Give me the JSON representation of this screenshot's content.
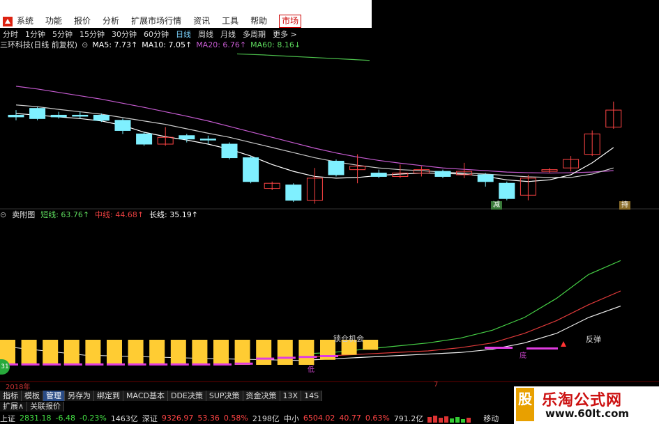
{
  "menu": {
    "items": [
      "系统",
      "功能",
      "报价",
      "分析",
      "扩展市场行情",
      "资讯",
      "工具",
      "帮助",
      "市场"
    ],
    "active_index": 8
  },
  "periods": {
    "items": [
      "分时",
      "1分钟",
      "5分钟",
      "15分钟",
      "30分钟",
      "60分钟",
      "日线",
      "周线",
      "月线",
      "多周期",
      "更多 >"
    ],
    "active_index": 6
  },
  "main_title": {
    "stock": "三环科技(日线 前复权)",
    "ma5": "MA5: 7.73↑",
    "ma10": "MA10: 7.05↑",
    "ma20": "MA20: 6.76↑",
    "ma60": "MA60: 8.16↓"
  },
  "sub_title": {
    "name": "卖附图",
    "short": "短线: 63.76↑",
    "mid": "中线: 44.68↑",
    "long": "长线: 35.19↑"
  },
  "annotations": {
    "buy_label": "减",
    "sell_label": "持",
    "bottom_label": "低",
    "mid_label": "底",
    "band_label": "锁仓机会",
    "rebound_label": "反弹"
  },
  "yearbar": {
    "year": "2018年",
    "month": "7"
  },
  "tabs": {
    "items": [
      "指标",
      "模板",
      "管理",
      "另存为",
      "绑定到",
      "MACD基本",
      "DDE决策",
      "SUP决策",
      "资金决策",
      "13X",
      "14S"
    ],
    "active_index": 2
  },
  "bottom_tabs": {
    "items": [
      "扩展∧",
      "关联报价"
    ]
  },
  "status": {
    "sh_name": "上证",
    "sh_val": "2831.18",
    "sh_chg": "-6.48",
    "sh_pct": "-0.23%",
    "sh_vol": "1463亿",
    "sz_name": "深证",
    "sz_val": "9326.97",
    "sz_chg": "53.36",
    "sz_pct": "0.58%",
    "sz_vol": "2198亿",
    "zx_name": "中小",
    "zx_val": "6504.02",
    "zx_chg": "40.77",
    "zx_pct": "0.63%",
    "zx_vol": "791.2亿",
    "move_label": "移动"
  },
  "watermark": {
    "title": "乐淘公式网",
    "url": "www.60lt.com",
    "mark": "股"
  },
  "circle_badge": "31",
  "colors": {
    "up": "#ff4444",
    "down_fill": "#7ff0ff",
    "ma20": "#c65bd1",
    "ma60": "#4cc04c",
    "bar_yellow": "#ffcc33",
    "bar_magenta": "#e03ce0"
  },
  "chart_data": {
    "type": "candlestick",
    "candles": [
      {
        "o": 7.55,
        "c": 7.5,
        "h": 7.7,
        "l": 7.4
      },
      {
        "o": 7.75,
        "c": 7.45,
        "h": 7.8,
        "l": 7.4
      },
      {
        "o": 7.55,
        "c": 7.5,
        "h": 7.65,
        "l": 7.45
      },
      {
        "o": 7.55,
        "c": 7.52,
        "h": 7.65,
        "l": 7.45
      },
      {
        "o": 7.55,
        "c": 7.4,
        "h": 7.6,
        "l": 7.35
      },
      {
        "o": 7.4,
        "c": 7.1,
        "h": 7.45,
        "l": 7.0
      },
      {
        "o": 7.0,
        "c": 6.7,
        "h": 7.05,
        "l": 6.65
      },
      {
        "o": 6.7,
        "c": 6.9,
        "h": 7.2,
        "l": 6.65
      },
      {
        "o": 6.95,
        "c": 6.85,
        "h": 7.0,
        "l": 6.75
      },
      {
        "o": 6.85,
        "c": 6.82,
        "h": 6.95,
        "l": 6.7
      },
      {
        "o": 6.7,
        "c": 6.3,
        "h": 6.75,
        "l": 6.25
      },
      {
        "o": 6.3,
        "c": 5.6,
        "h": 6.35,
        "l": 5.55
      },
      {
        "o": 5.4,
        "c": 5.55,
        "h": 5.6,
        "l": 5.35
      },
      {
        "o": 5.5,
        "c": 5.05,
        "h": 5.55,
        "l": 5.0
      },
      {
        "o": 5.05,
        "c": 5.7,
        "h": 6.0,
        "l": 4.95
      },
      {
        "o": 6.2,
        "c": 5.8,
        "h": 6.25,
        "l": 5.75
      },
      {
        "o": 5.95,
        "c": 6.05,
        "h": 6.4,
        "l": 5.55
      },
      {
        "o": 5.85,
        "c": 5.75,
        "h": 5.95,
        "l": 5.7
      },
      {
        "o": 5.75,
        "c": 5.85,
        "h": 6.1,
        "l": 5.7
      },
      {
        "o": 5.85,
        "c": 5.95,
        "h": 6.05,
        "l": 5.75
      },
      {
        "o": 5.9,
        "c": 5.75,
        "h": 5.95,
        "l": 5.7
      },
      {
        "o": 5.8,
        "c": 5.9,
        "h": 6.15,
        "l": 5.7
      },
      {
        "o": 5.8,
        "c": 5.6,
        "h": 5.85,
        "l": 5.45
      },
      {
        "o": 5.55,
        "c": 5.1,
        "h": 5.6,
        "l": 5.05
      },
      {
        "o": 5.2,
        "c": 5.7,
        "h": 5.8,
        "l": 5.05
      },
      {
        "o": 5.9,
        "c": 5.95,
        "h": 6.0,
        "l": 5.85
      },
      {
        "o": 6.0,
        "c": 6.25,
        "h": 6.35,
        "l": 5.9
      },
      {
        "o": 6.4,
        "c": 7.0,
        "h": 7.1,
        "l": 6.35
      },
      {
        "o": 7.2,
        "c": 7.7,
        "h": 7.95,
        "l": 7.15
      }
    ],
    "ma5": [
      7.6,
      7.55,
      7.5,
      7.45,
      7.38,
      7.25,
      7.05,
      6.92,
      6.82,
      6.7,
      6.55,
      6.35,
      6.1,
      5.9,
      5.75,
      5.7,
      5.72,
      5.78,
      5.82,
      5.85,
      5.84,
      5.82,
      5.75,
      5.65,
      5.6,
      5.65,
      5.8,
      6.15,
      6.6
    ],
    "ma10": [
      7.85,
      7.8,
      7.72,
      7.65,
      7.58,
      7.48,
      7.38,
      7.28,
      7.15,
      7.02,
      6.9,
      6.75,
      6.6,
      6.45,
      6.3,
      6.18,
      6.08,
      6.0,
      5.95,
      5.92,
      5.88,
      5.85,
      5.82,
      5.78,
      5.74,
      5.72,
      5.72,
      5.82,
      6.0
    ],
    "ma20": [
      8.4,
      8.32,
      8.22,
      8.12,
      8.02,
      7.9,
      7.78,
      7.65,
      7.52,
      7.38,
      7.22,
      7.06,
      6.9,
      6.74,
      6.58,
      6.44,
      6.32,
      6.22,
      6.14,
      6.07,
      6.0,
      5.96,
      5.92,
      5.88,
      5.86,
      5.85,
      5.86,
      5.88,
      5.92
    ],
    "ma60_segment": [
      9.35,
      9.32,
      9.28,
      9.24,
      9.2,
      9.16
    ],
    "sub_series": [
      {
        "name": "短线",
        "values": [
          5,
          6,
          8,
          10,
          12,
          15,
          20,
          28,
          40,
          55,
          63.76
        ]
      },
      {
        "name": "中线",
        "values": [
          3,
          4,
          5,
          6,
          7,
          9,
          12,
          18,
          26,
          36,
          44.68
        ]
      },
      {
        "name": "长线",
        "values": [
          1,
          2,
          3,
          4,
          5,
          6,
          8,
          12,
          18,
          28,
          35.19
        ]
      }
    ],
    "bars": [
      1,
      1,
      1,
      1,
      1,
      1,
      1,
      1,
      1,
      1,
      1,
      1,
      1,
      1,
      1,
      0.8,
      0.6,
      0.4
    ]
  }
}
